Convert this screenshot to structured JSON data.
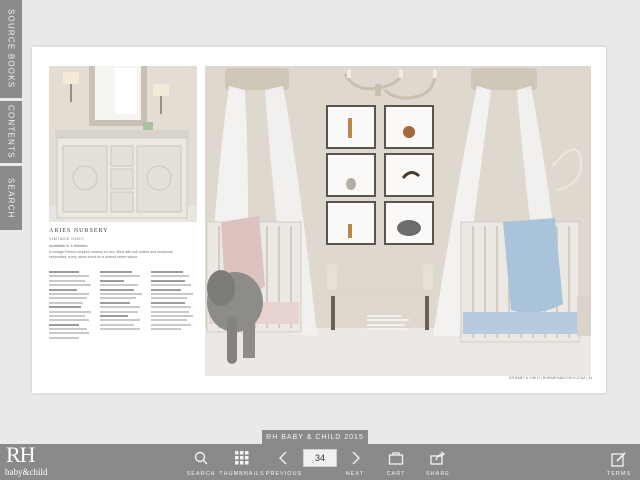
{
  "side_tabs": [
    "SOURCE BOOKS",
    "CONTENTS",
    "SEARCH"
  ],
  "spread": {
    "section_title": "ARIES NURSERY",
    "section_subtitle": "VINTAGE GREY",
    "availability": "Available in 4 finishes.",
    "intro": "A vintage French-inspired nursery for two, filled with soft whites and storybook keepsakes; every piece sized for a shared sweet space.",
    "folio": "RH BABY & CHILD  |  RHBABYANDCHILD.COM  |  34"
  },
  "issue_label": "RH BABY & CHILD 2015",
  "logo": {
    "mark": "RH",
    "sub": "baby&child"
  },
  "toolbar": {
    "search": "SEARCH",
    "thumbnails": "THUMBNAILS",
    "previous": "PREVIOUS",
    "page": "34",
    "next": "NEXT",
    "cart": "CART",
    "share": "SHARE",
    "terms": "TERMS"
  },
  "colors": {
    "bar": "#8a8a88",
    "tabs": "#8b8b89",
    "background": "#e9e9e7"
  }
}
